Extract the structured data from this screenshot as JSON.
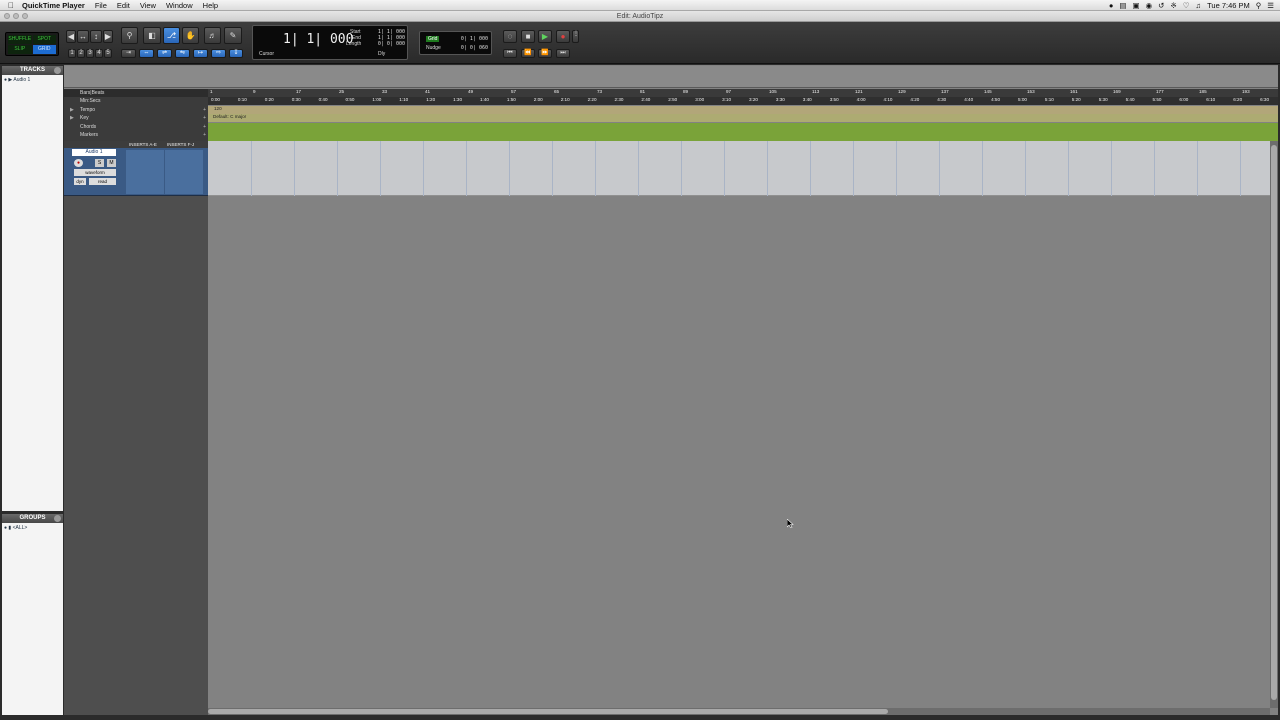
{
  "menubar": {
    "app": "QuickTime Player",
    "items": [
      "File",
      "Edit",
      "View",
      "Window",
      "Help"
    ],
    "clock": "Tue 7:46 PM"
  },
  "window": {
    "title": "Edit: AudioTipz"
  },
  "toolbar": {
    "modes": [
      "SHUFFLE",
      "SPOT",
      "SLIP",
      "GRID"
    ],
    "zoom_presets": [
      "1",
      "2",
      "3",
      "4",
      "5"
    ]
  },
  "counter": {
    "main": "1| 1| 000",
    "cursor_label": "Cursor",
    "start_label": "Start",
    "end_label": "End",
    "length_label": "Length",
    "start": "1| 1| 000",
    "end": "1| 1| 000",
    "length": "0| 0| 000",
    "dly": "Dly"
  },
  "grid_nudge": {
    "grid_label": "Grid",
    "nudge_label": "Nudge",
    "grid_value": "0| 1| 000",
    "nudge_value": "0| 0| 060"
  },
  "tracks_panel": {
    "title": "TRACKS",
    "items": [
      "Audio 1"
    ]
  },
  "groups_panel": {
    "title": "GROUPS",
    "items": [
      "<ALL>"
    ]
  },
  "rulers": {
    "names": [
      "Bars|Beats",
      "Min:Secs",
      "Tempo",
      "Key",
      "Chords",
      "Markers"
    ],
    "bars": [
      "1",
      "9",
      "17",
      "25",
      "33",
      "41",
      "49",
      "57",
      "65",
      "73",
      "81",
      "89",
      "97",
      "105",
      "113",
      "121",
      "129",
      "137",
      "145",
      "153",
      "161",
      "169",
      "177",
      "185",
      "193"
    ],
    "minsecs": [
      "0:00",
      "0:10",
      "0:20",
      "0:30",
      "0:40",
      "0:50",
      "1:00",
      "1:10",
      "1:20",
      "1:30",
      "1:40",
      "1:50",
      "2:00",
      "2:10",
      "2:20",
      "2:30",
      "2:40",
      "2:50",
      "3:00",
      "3:10",
      "3:20",
      "3:30",
      "3:40",
      "3:50",
      "4:00",
      "4:10",
      "4:20",
      "4:30",
      "4:40",
      "4:50",
      "5:00",
      "5:10",
      "5:20",
      "5:30",
      "5:40",
      "5:50",
      "6:00",
      "6:10",
      "6:20",
      "6:30"
    ],
    "tempo": "120",
    "key": "Default: C major"
  },
  "track": {
    "name": "Audio 1",
    "inserts_ae": "INSERTS A-E",
    "inserts_fj": "INSERTS F-J",
    "view": "waveform",
    "dyn": "dyn",
    "automation": "read",
    "solo": "S",
    "mute": "M"
  }
}
